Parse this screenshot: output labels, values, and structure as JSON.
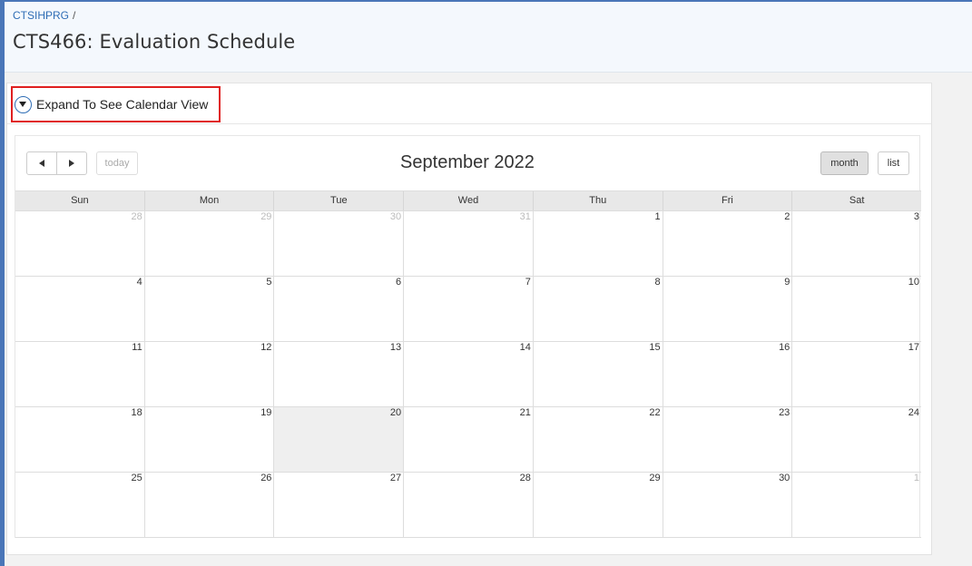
{
  "breadcrumb": {
    "parent": "CTSIHPRG",
    "separator": "/"
  },
  "page": {
    "title": "CTS466: Evaluation Schedule"
  },
  "region": {
    "expand_label": "Expand To See Calendar View"
  },
  "calendar": {
    "title": "September 2022",
    "today_label": "today",
    "month_label": "month",
    "list_label": "list",
    "days_of_week": [
      "Sun",
      "Mon",
      "Tue",
      "Wed",
      "Thu",
      "Fri",
      "Sat"
    ],
    "weeks": [
      [
        {
          "d": "28",
          "other": true
        },
        {
          "d": "29",
          "other": true
        },
        {
          "d": "30",
          "other": true
        },
        {
          "d": "31",
          "other": true
        },
        {
          "d": "1"
        },
        {
          "d": "2"
        },
        {
          "d": "3"
        }
      ],
      [
        {
          "d": "4"
        },
        {
          "d": "5"
        },
        {
          "d": "6"
        },
        {
          "d": "7"
        },
        {
          "d": "8"
        },
        {
          "d": "9"
        },
        {
          "d": "10"
        }
      ],
      [
        {
          "d": "11"
        },
        {
          "d": "12"
        },
        {
          "d": "13"
        },
        {
          "d": "14"
        },
        {
          "d": "15"
        },
        {
          "d": "16"
        },
        {
          "d": "17"
        }
      ],
      [
        {
          "d": "18"
        },
        {
          "d": "19"
        },
        {
          "d": "20",
          "today": true
        },
        {
          "d": "21"
        },
        {
          "d": "22"
        },
        {
          "d": "23"
        },
        {
          "d": "24"
        }
      ],
      [
        {
          "d": "25"
        },
        {
          "d": "26"
        },
        {
          "d": "27"
        },
        {
          "d": "28"
        },
        {
          "d": "29"
        },
        {
          "d": "30"
        },
        {
          "d": "1",
          "other": true
        }
      ]
    ]
  },
  "colors": {
    "accent": "#2f6db5",
    "frame": "#4a76b8",
    "highlight": "#e02020"
  }
}
